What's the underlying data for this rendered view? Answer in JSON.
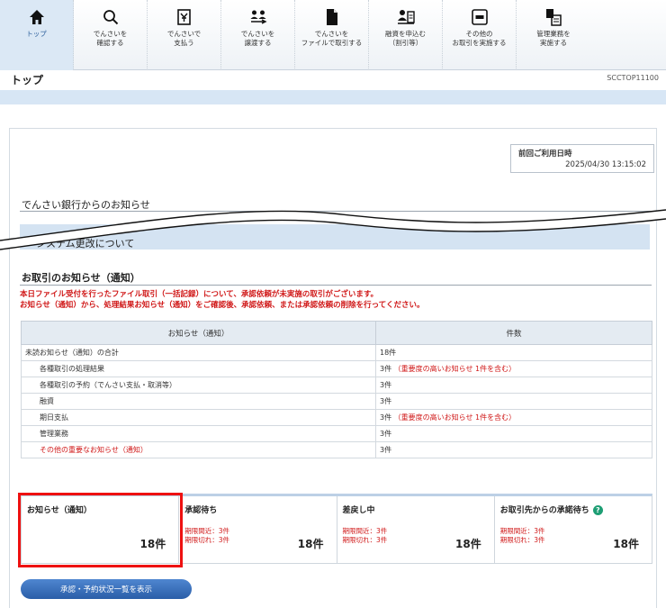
{
  "nav": [
    {
      "label": "トップ",
      "icon": "home-icon"
    },
    {
      "label": "でんさいを\n確認する",
      "icon": "search-icon"
    },
    {
      "label": "でんさいで\n支払う",
      "icon": "payment-icon"
    },
    {
      "label": "でんさいを\n譲渡する",
      "icon": "transfer-icon"
    },
    {
      "label": "でんさいを\nファイルで取引する",
      "icon": "file-icon"
    },
    {
      "label": "融資を申込む\n（割引等）",
      "icon": "loan-icon"
    },
    {
      "label": "その他の\nお取引を実施する",
      "icon": "other-icon"
    },
    {
      "label": "管理業務を\n実施する",
      "icon": "admin-icon"
    }
  ],
  "page": {
    "title": "トップ",
    "screen_id": "SCCTOP11100"
  },
  "last_login": {
    "label": "前回ご利用日時",
    "value": "2025/04/30 13:15:02"
  },
  "bank_notice": {
    "heading": "でんさい銀行からのお知らせ",
    "item": "システム更改について"
  },
  "trade_notice": {
    "heading": "お取引のお知らせ（通知）",
    "message": "本日ファイル受付を行ったファイル取引（一括記録）について、承認依頼が未実施の取引がございます。\nお知らせ（通知）から、処理結果お知らせ（通知）をご確認後、承認依頼、または承認依頼の削除を行ってください。",
    "columns": [
      "お知らせ（通知）",
      "件数"
    ],
    "rows": [
      {
        "name": "未読お知らせ（通知）の合計",
        "count": "18件",
        "note": "",
        "indent": false,
        "red": false
      },
      {
        "name": "各種取引の処理結果",
        "count": "3件",
        "note": "（重要度の高いお知らせ 1件を含む）",
        "indent": true,
        "red": false
      },
      {
        "name": "各種取引の予約（でんさい支払・取消等）",
        "count": "3件",
        "note": "",
        "indent": true,
        "red": false
      },
      {
        "name": "融資",
        "count": "3件",
        "note": "",
        "indent": true,
        "red": false
      },
      {
        "name": "期日支払",
        "count": "3件",
        "note": "（重要度の高いお知らせ 1件を含む）",
        "indent": true,
        "red": false
      },
      {
        "name": "管理業務",
        "count": "3件",
        "note": "",
        "indent": true,
        "red": false
      },
      {
        "name": "その他の重要なお知らせ（通知）",
        "count": "3件",
        "note": "",
        "indent": true,
        "red": true
      }
    ]
  },
  "summary": [
    {
      "title": "お知らせ（通知）",
      "count": "18件",
      "sub1": "",
      "sub2": ""
    },
    {
      "title": "承認待ち",
      "count": "18件",
      "sub1": "期限間近：3件",
      "sub2": "期限切れ：3件"
    },
    {
      "title": "差戻し中",
      "count": "18件",
      "sub1": "期限間近：3件",
      "sub2": "期限切れ：3件"
    },
    {
      "title": "お取引先からの承諾待ち",
      "count": "18件",
      "sub1": "期限間近：3件",
      "sub2": "期限切れ：3件"
    }
  ],
  "list_button": "承認・予約状況一覧を表示",
  "colors": {
    "accent": "#2a5ea8",
    "alert": "#d01818",
    "highlight": "#ee1111"
  }
}
